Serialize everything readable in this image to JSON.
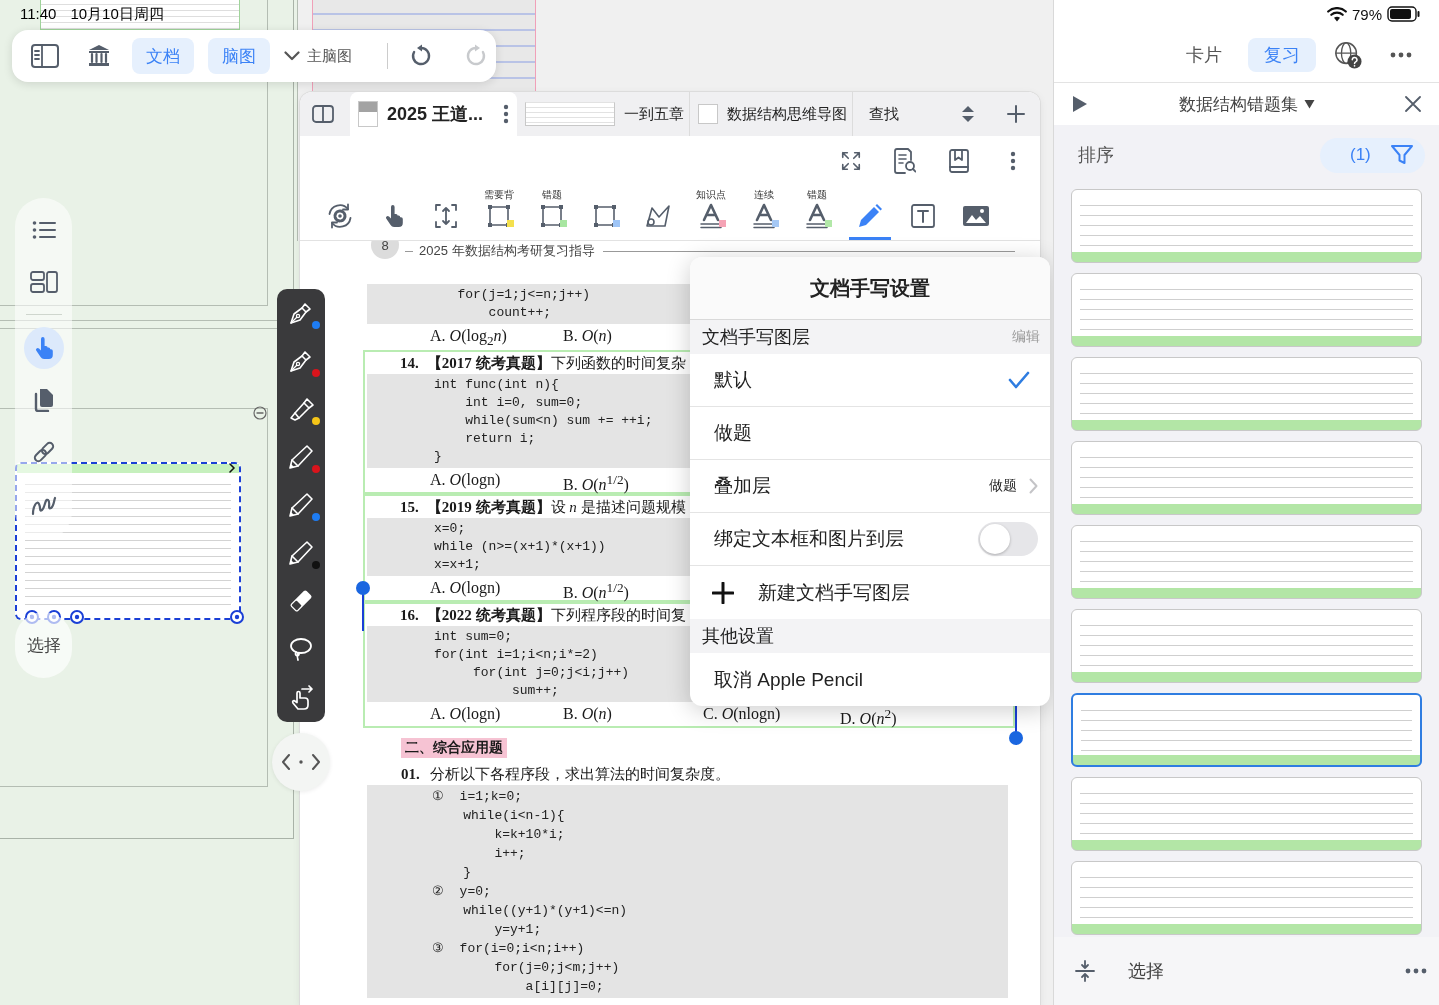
{
  "status_bar": {
    "time": "11:40",
    "date": "10月10日周四",
    "battery": "79%"
  },
  "top_toolbar": {
    "toggles": [
      {
        "label": "文档",
        "on": true
      },
      {
        "label": "脑图",
        "on": true
      }
    ],
    "map_picker": "主脑图",
    "history": [
      {
        "kind": "undo",
        "disabled": false
      },
      {
        "kind": "redo",
        "disabled": true
      }
    ]
  },
  "side_toolbar": {
    "tools": [
      {
        "kind": "outline",
        "selected": false
      },
      {
        "kind": "layout",
        "selected": false
      },
      {
        "kind": "pointer",
        "selected": true
      },
      {
        "kind": "copy",
        "selected": false
      },
      {
        "kind": "link",
        "selected": false
      },
      {
        "kind": "freehand",
        "selected": false
      }
    ],
    "select_button": "选择"
  },
  "canvas": {
    "snippet": {
      "selected": true
    }
  },
  "pen_toolbar": {
    "tools": [
      {
        "kind": "fountain-pen",
        "color": "#1e7cf2"
      },
      {
        "kind": "fountain-pen",
        "color": "#d9141c"
      },
      {
        "kind": "highlighter",
        "color": "#f5c518"
      },
      {
        "kind": "pencil",
        "color": "#d9141c"
      },
      {
        "kind": "pencil",
        "color": "#1e7cf2"
      },
      {
        "kind": "pencil",
        "color": "#111111"
      },
      {
        "kind": "eraser"
      },
      {
        "kind": "lasso"
      },
      {
        "kind": "gesture"
      }
    ]
  },
  "document": {
    "tabs": [
      {
        "title": "2025 王道...",
        "selected": true,
        "kind": "cover"
      },
      {
        "title": "一到五章",
        "selected": false,
        "kind": "page"
      },
      {
        "title": "数据结构思维导图",
        "selected": false,
        "kind": "blank"
      },
      {
        "title": "查找",
        "selected": false,
        "kind": "clipped"
      }
    ],
    "tools": [
      {
        "kind": "rotate",
        "selected": false
      },
      {
        "kind": "pointer",
        "selected": false
      },
      {
        "kind": "resize",
        "selected": false
      },
      {
        "kind": "frame",
        "label": "需要背",
        "color": "#f4e04d",
        "selected": false
      },
      {
        "kind": "frame",
        "label": "错题",
        "color": "#a8e6a1",
        "selected": false
      },
      {
        "kind": "frame",
        "color": "#9ec5f7",
        "selected": false
      },
      {
        "kind": "polygon",
        "selected": false
      },
      {
        "kind": "text-mark",
        "label": "知识点",
        "color": "#f5a3b5",
        "selected": false
      },
      {
        "kind": "text-mark",
        "label": "连续",
        "color": "#a5c8f5",
        "selected": false
      },
      {
        "kind": "text-mark",
        "label": "错题",
        "color": "#b2e8a8",
        "selected": false
      },
      {
        "kind": "pen",
        "selected": true
      },
      {
        "kind": "text-box",
        "selected": false
      },
      {
        "kind": "image",
        "selected": false
      }
    ],
    "page": {
      "number": "8",
      "running_title": "2025 年数据结构考研复习指导",
      "questions": [
        {
          "framed": false,
          "code": [
            "   for(j=1;j<=n;j++)",
            "       count++;"
          ],
          "options": [
            "A. *O*(log$_{2}$*n*)",
            "B. *O*(*n*)"
          ]
        },
        {
          "number": "14.",
          "title": "**【2017 统考真题】**下列函数的时间复杂",
          "framed": true,
          "code": [
            "int func(int n){",
            "    int i=0, sum=0;",
            "    while(sum<n) sum += ++i;",
            "    return i;",
            "}"
          ],
          "options": [
            "A. *O*(logn)",
            "B. *O*(*n*$^{1/2}$)"
          ]
        },
        {
          "number": "15.",
          "title": "**【2019 统考真题】**设 *n* 是描述问题规模",
          "framed": true,
          "code": [
            "x=0;",
            "while (n>=(x+1)*(x+1))",
            "x=x+1;"
          ],
          "options": [
            "A. *O*(logn)",
            "B. *O*(*n*$^{1/2}$)"
          ]
        },
        {
          "number": "16.",
          "title": "**【2022 统考真题】**下列程序段的时间复",
          "framed": true,
          "code": [
            "int sum=0;",
            "for(int i=1;i<n;i*=2)",
            "     for(int j=0;j<i;j++)",
            "          sum++;"
          ],
          "options": [
            "A. *O*(logn)",
            "B. *O*(*n*)",
            "C. *O*(nlogn)",
            "D. *O*(*n*$^{2}$)"
          ]
        }
      ],
      "section": {
        "heading": "二、综合应用题",
        "number": "01.",
        "text": "分析以下各程序段，求出算法的时间复杂度。",
        "code": [
          "①  i=1;k=0;",
          "    while(i<n-1){",
          "        k=k+10*i;",
          "        i++;",
          "    }",
          "②  y=0;",
          "    while((y+1)*(y+1)<=n)",
          "        y=y+1;",
          "③  for(i=0;i<n;i++)",
          "        for(j=0;j<m;j++)",
          "            a[i][j]=0;"
        ]
      }
    }
  },
  "handwriting_menu": {
    "title": "文档手写设置",
    "layers_header": "文档手写图层",
    "edit": "编辑",
    "layers": [
      {
        "label": "默认",
        "selected": true
      },
      {
        "label": "做题",
        "selected": false
      }
    ],
    "overlay": {
      "label": "叠加层",
      "value": "做题"
    },
    "bind": {
      "label": "绑定文本框和图片到层",
      "on": false
    },
    "new_layer": "新建文档手写图层",
    "other_header": "其他设置",
    "cancel_pencil": "取消 Apple Pencil"
  },
  "review_panel": {
    "tabs": [
      {
        "label": "卡片",
        "selected": false
      },
      {
        "label": "复习",
        "selected": true
      }
    ],
    "deck": "数据结构错题集",
    "sort": "排序",
    "filter_count": "(1)",
    "cards": [
      {
        "selected": false
      },
      {
        "selected": false
      },
      {
        "selected": false
      },
      {
        "selected": false
      },
      {
        "selected": false
      },
      {
        "selected": false
      },
      {
        "selected": true
      },
      {
        "selected": false
      },
      {
        "selected": false
      }
    ],
    "select_button": "选择"
  }
}
